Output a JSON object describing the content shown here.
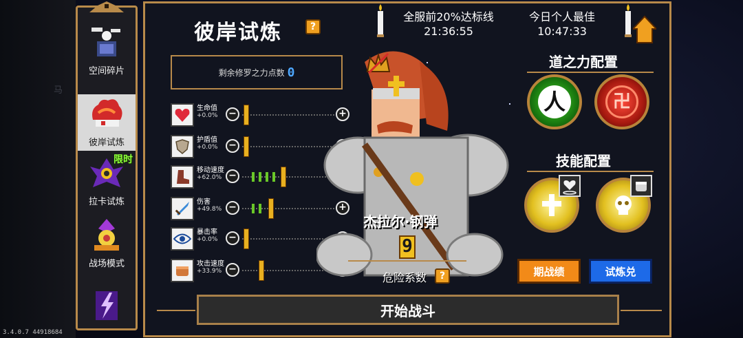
{
  "left_faded": "马",
  "version": "3.4.0.7 44918684",
  "sidebar": {
    "items": [
      {
        "label": "空间碎片"
      },
      {
        "label": "彼岸试炼"
      },
      {
        "label": "拉卡试炼",
        "badge": "限时"
      },
      {
        "label": "战场模式"
      }
    ]
  },
  "header": {
    "title": "彼岸试炼",
    "help": "?"
  },
  "leaderboard": {
    "global_label": "全服前20%达标线",
    "global_time": "21:36:55",
    "personal_label": "今日个人最佳",
    "personal_time": "10:47:33"
  },
  "points": {
    "label": "剩余修罗之力点数",
    "value": "0"
  },
  "stats": [
    {
      "name": "生命值",
      "pct": "+0.0%",
      "icon": "heart-icon",
      "level": 0
    },
    {
      "name": "护盾值",
      "pct": "+0.0%",
      "icon": "shield-icon",
      "level": 0
    },
    {
      "name": "移动速度",
      "pct": "+62.0%",
      "icon": "boot-icon",
      "level": 4
    },
    {
      "name": "伤害",
      "pct": "+49.8%",
      "icon": "sword-icon",
      "level": 2
    },
    {
      "name": "暴击率",
      "pct": "+0.0%",
      "icon": "eye-icon",
      "level": 0
    },
    {
      "name": "攻击速度",
      "pct": "+33.9%",
      "icon": "fist-icon",
      "level": 0
    }
  ],
  "hero": {
    "name": "杰拉尔·钢弹",
    "danger_value": "9",
    "danger_label": "危险系数"
  },
  "power_config": {
    "title": "道之力配置",
    "left_glyph": "人",
    "right_glyph": "卍"
  },
  "skill_config": {
    "title": "技能配置"
  },
  "buttons": {
    "history": "期战绩",
    "trial_redeem": "试炼兑",
    "start": "开始战斗"
  },
  "colors": {
    "gold": "#b88a4a",
    "orange": "#f28a18",
    "blue": "#1d6ae8",
    "green_power": "#2a9a1a",
    "red_power": "#b8221a"
  }
}
